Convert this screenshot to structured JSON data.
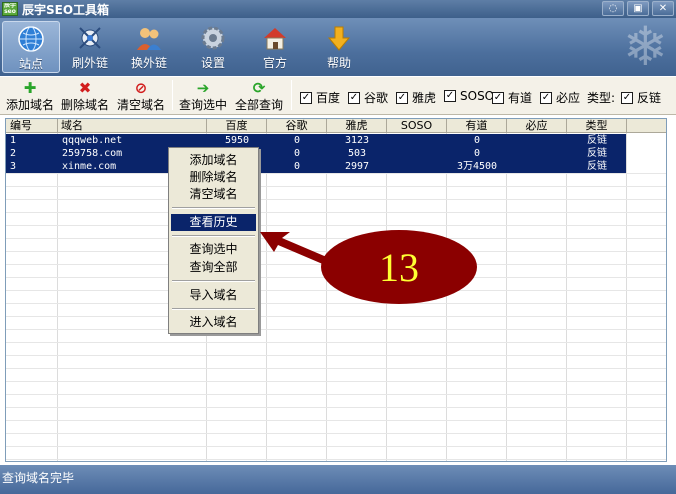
{
  "window": {
    "title": "辰宇SEO工具箱",
    "logo_text": "辰宇seo",
    "controls": [
      "restore-icon",
      "maximize-icon",
      "close-icon"
    ]
  },
  "toolbar": {
    "items": [
      {
        "label": "站点",
        "icon": "globe-icon",
        "active": true
      },
      {
        "label": "刷外链",
        "icon": "satellite-icon",
        "active": false
      },
      {
        "label": "换外链",
        "icon": "users-icon",
        "active": false
      },
      {
        "label": "设置",
        "icon": "gear-icon",
        "active": false
      },
      {
        "label": "官方",
        "icon": "home-icon",
        "active": false
      },
      {
        "label": "帮助",
        "icon": "help-arrow-icon",
        "active": false
      }
    ]
  },
  "actions": {
    "add": "添加域名",
    "delete": "删除域名",
    "clear": "清空域名",
    "query_selected": "查询选中",
    "query_all": "全部查询",
    "type_label": "类型:"
  },
  "checks": [
    {
      "label": "百度",
      "checked": true
    },
    {
      "label": "谷歌",
      "checked": true
    },
    {
      "label": "雅虎",
      "checked": true
    },
    {
      "label": "SOSO",
      "checked": true
    },
    {
      "label": "有道",
      "checked": true
    },
    {
      "label": "必应",
      "checked": true
    }
  ],
  "type_check": {
    "label": "反链",
    "checked": true
  },
  "table": {
    "columns": [
      "编号",
      "域名",
      "百度",
      "谷歌",
      "雅虎",
      "SOSO",
      "有道",
      "必应",
      "类型"
    ],
    "rows": [
      [
        "1",
        "qqqweb.net",
        "5950",
        "0",
        "3123",
        "",
        "0",
        "",
        "反链"
      ],
      [
        "2",
        "259758.com",
        "",
        "0",
        "503",
        "",
        "0",
        "",
        "反链"
      ],
      [
        "3",
        "xinme.com",
        "",
        "0",
        "2997",
        "",
        "3万4500",
        "",
        "反链"
      ]
    ]
  },
  "context_menu": {
    "items": [
      "添加域名",
      "删除域名",
      "清空域名",
      "查看历史",
      "查询选中",
      "查询全部",
      "导入域名",
      "进入域名"
    ],
    "highlighted": "查看历史"
  },
  "callout": {
    "text": "13",
    "color": "#8b0000",
    "text_color": "#ffff33"
  },
  "status": {
    "text": "查询域名完毕"
  }
}
